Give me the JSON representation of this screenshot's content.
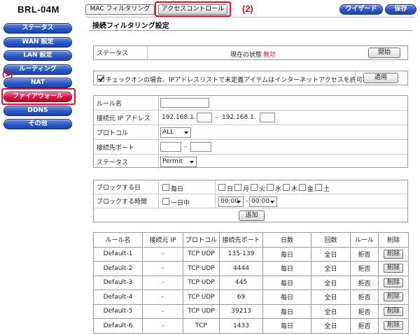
{
  "brand": "BRL-04M",
  "sidebar": {
    "items": [
      {
        "label": "ステータス"
      },
      {
        "label": "WAN 設定"
      },
      {
        "label": "LAN 設定"
      },
      {
        "label": "ルーティング"
      },
      {
        "label": "NAT"
      },
      {
        "label": "ファイアウォール"
      },
      {
        "label": "DDNS"
      },
      {
        "label": "その他"
      }
    ],
    "active": "ファイアウォール"
  },
  "tabs": [
    {
      "label": "MAC フィルタリング"
    },
    {
      "label": "アクセスコントロール"
    }
  ],
  "toolbar": {
    "wizard_label": "ウイザード",
    "save_label": "保存"
  },
  "callouts": {
    "one": "(1)",
    "two": "(2)"
  },
  "colors": {
    "nav_blue": "#2a56c9",
    "nav_active": "#e01040",
    "highlight": "#e0102a",
    "status_disabled": "#e0102a"
  },
  "section_title": "接続フィルタリング設定",
  "status_panel": {
    "label": "ステータス",
    "state_prefix": "現在の状態",
    "state_value": "無効",
    "start_button": "開始"
  },
  "allow_panel": {
    "checked": true,
    "text": "チェックオンの場合、IPアドレスリストで未定義アイテムはインターネットアクセスを許可",
    "apply_button": "適用"
  },
  "rule_form": {
    "name_label": "ルール名",
    "name_value": "",
    "src_ip_label": "接続元 IP アドレス",
    "ip_prefix_1": "192.168.1.",
    "ip_sep": "–",
    "ip_prefix_2": "192.168.1.",
    "protocol_label": "プロトコル",
    "protocol_value": "ALL",
    "dst_port_label": "接続先ポート",
    "port_sep": "–",
    "status_label": "ステータス",
    "status_value": "Permit"
  },
  "schedule": {
    "block_day_label": "ブロックする日",
    "every_day": "毎日",
    "days": [
      "日",
      "月",
      "火",
      "水",
      "木",
      "金",
      "土"
    ],
    "block_time_label": "ブロックする時間",
    "all_day": "一日中",
    "time_from": "00:00",
    "time_sep": "-",
    "time_to": "00:00",
    "add_button": "追加"
  },
  "rules_table": {
    "headers": [
      "ルール名",
      "接続元 IP",
      "プロトコル",
      "接続先ポート",
      "日数",
      "回数",
      "ルール",
      "削除"
    ],
    "rows": [
      [
        "Default-1",
        "-",
        "TCP UDP",
        "135-139",
        "毎日",
        "全日",
        "拒否",
        "削除"
      ],
      [
        "Default-2",
        "-",
        "TCP UDP",
        "4444",
        "毎日",
        "全日",
        "拒否",
        "削除"
      ],
      [
        "Default-3",
        "-",
        "TCP UDP",
        "445",
        "毎日",
        "全日",
        "拒否",
        "削除"
      ],
      [
        "Default-4",
        "-",
        "TCP UDP",
        "69",
        "毎日",
        "全日",
        "拒否",
        "削除"
      ],
      [
        "Default-5",
        "-",
        "TCP UDP",
        "39213",
        "毎日",
        "全日",
        "拒否",
        "削除"
      ],
      [
        "Default-6",
        "-",
        "TCP",
        "1433",
        "毎日",
        "全日",
        "拒否",
        "削除"
      ]
    ]
  }
}
